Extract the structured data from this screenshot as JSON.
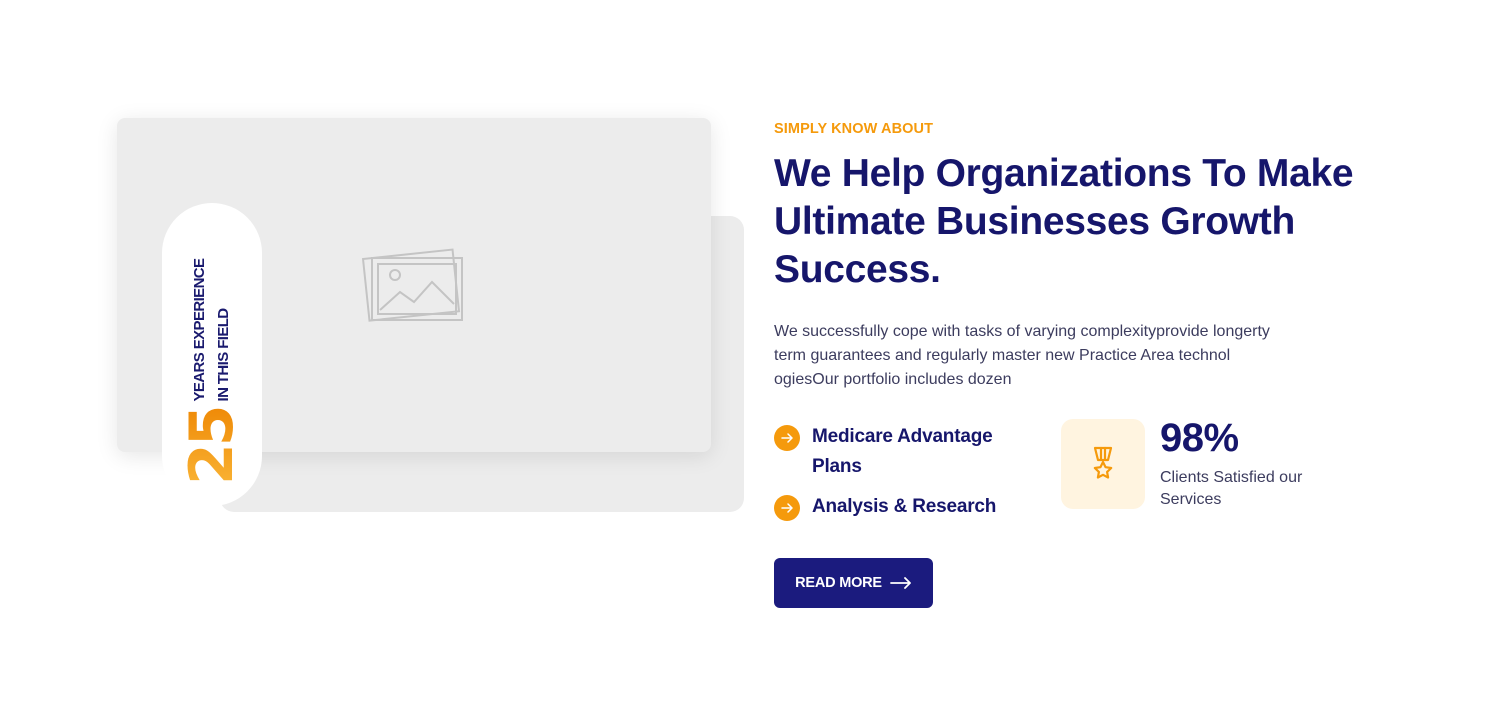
{
  "experience": {
    "number": "25",
    "line1": "YEARS EXPERIENCE",
    "line2": "IN THIS FIELD"
  },
  "about": {
    "eyebrow": "SIMPLY KNOW ABOUT",
    "heading": "We Help Organizations To Make Ultimate Businesses Growth Success.",
    "description": "We successfully cope with tasks of varying complexityprovide longerty term guarantees and regularly master new Practice Area technol ogiesOur portfolio includes dozen"
  },
  "features": [
    {
      "label": "Medicare Advantage Plans",
      "icon": "arrow-right-icon"
    },
    {
      "label": "Analysis & Research",
      "icon": "arrow-right-icon"
    }
  ],
  "stat": {
    "value": "98%",
    "label": "Clients Satisfied our Services",
    "icon": "award-icon"
  },
  "cta": {
    "label": "READ MORE",
    "icon": "long-arrow-right-icon"
  },
  "colors": {
    "accent": "#f59a0c",
    "navy": "#16166b",
    "button": "#1b1b7e",
    "placeholder": "#ececec",
    "stat_bg": "#fff4e0"
  }
}
